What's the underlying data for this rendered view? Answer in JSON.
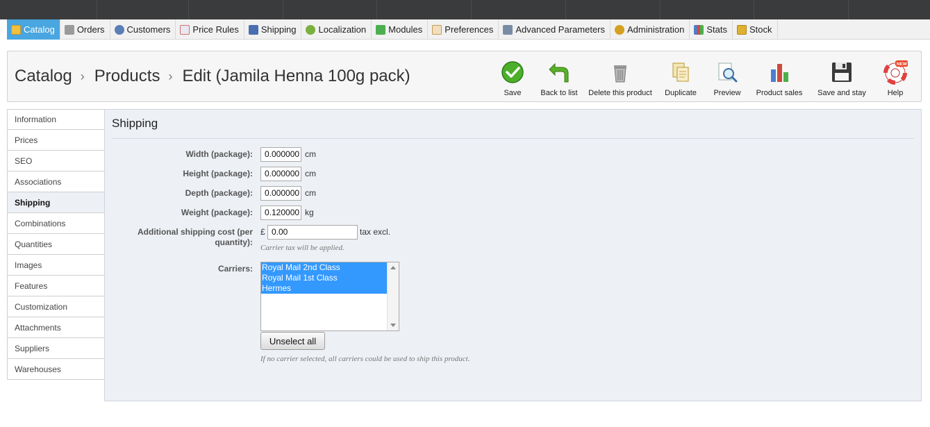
{
  "nav": {
    "items": [
      {
        "label": "Catalog",
        "icon": "catalog-icon",
        "color": "#f0c040",
        "active": true
      },
      {
        "label": "Orders",
        "icon": "cart-icon",
        "color": "#8a8a8a"
      },
      {
        "label": "Customers",
        "icon": "user-icon",
        "color": "#5a7fb5"
      },
      {
        "label": "Price Rules",
        "icon": "price-rules-icon",
        "color": "#d07070"
      },
      {
        "label": "Shipping",
        "icon": "truck-icon",
        "color": "#4a6fb0"
      },
      {
        "label": "Localization",
        "icon": "globe-icon",
        "color": "#7ab040"
      },
      {
        "label": "Modules",
        "icon": "puzzle-icon",
        "color": "#4caf50"
      },
      {
        "label": "Preferences",
        "icon": "preferences-icon",
        "color": "#c49a50"
      },
      {
        "label": "Advanced Parameters",
        "icon": "wrench-icon",
        "color": "#7a8ba5"
      },
      {
        "label": "Administration",
        "icon": "key-icon",
        "color": "#d4a020"
      },
      {
        "label": "Stats",
        "icon": "stats-icon",
        "color": "#4a7fd0"
      },
      {
        "label": "Stock",
        "icon": "stock-icon",
        "color": "#e0b030"
      }
    ]
  },
  "header": {
    "crumb1": "Catalog",
    "crumb2": "Products",
    "crumb3": "Edit (Jamila Henna 100g pack)",
    "sep": "›"
  },
  "toolbar": {
    "save": "Save",
    "back": "Back to list",
    "delete": "Delete this product",
    "duplicate": "Duplicate",
    "preview": "Preview",
    "sales": "Product sales",
    "save_stay": "Save and stay",
    "help": "Help",
    "help_badge": "NEW"
  },
  "tabs": [
    {
      "label": "Information"
    },
    {
      "label": "Prices"
    },
    {
      "label": "SEO"
    },
    {
      "label": "Associations"
    },
    {
      "label": "Shipping",
      "active": true
    },
    {
      "label": "Combinations"
    },
    {
      "label": "Quantities"
    },
    {
      "label": "Images"
    },
    {
      "label": "Features"
    },
    {
      "label": "Customization"
    },
    {
      "label": "Attachments"
    },
    {
      "label": "Suppliers"
    },
    {
      "label": "Warehouses"
    }
  ],
  "shipping": {
    "title": "Shipping",
    "width_label": "Width (package):",
    "width_value": "0.000000",
    "height_label": "Height (package):",
    "height_value": "0.000000",
    "depth_label": "Depth (package):",
    "depth_value": "0.000000",
    "weight_label": "Weight (package):",
    "weight_value": "0.120000",
    "unit_cm": "cm",
    "unit_kg": "kg",
    "additional_label_1": "Additional shipping cost (per",
    "additional_label_2": "quantity):",
    "currency": "£",
    "additional_value": "0.00",
    "tax_excl": "tax excl.",
    "carrier_tax_hint": "Carrier tax will be applied.",
    "carriers_label": "Carriers:",
    "carriers": [
      "Royal Mail 2nd Class",
      "Royal Mail 1st Class",
      "Hermes"
    ],
    "unselect_all": "Unselect all",
    "no_carrier_hint": "If no carrier selected, all carriers could be used to ship this product."
  },
  "colors": {
    "nav_active": "#49a6e0",
    "selection": "#3399ff",
    "panel_bg": "#edf0f5"
  }
}
